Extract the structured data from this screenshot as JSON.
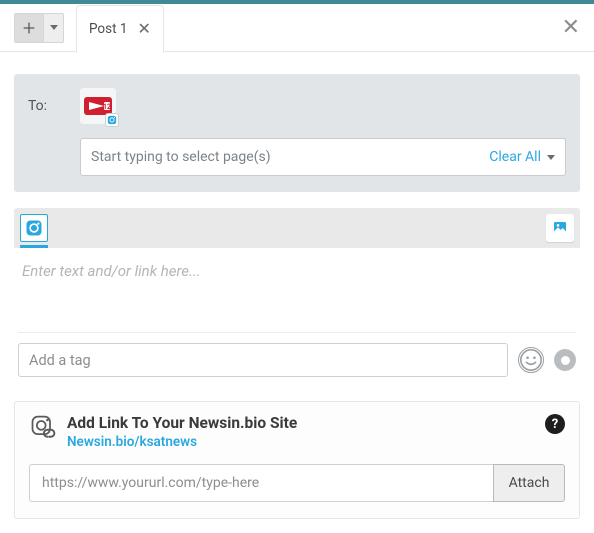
{
  "tab": {
    "label": "Post 1"
  },
  "to": {
    "label": "To:",
    "page_input_placeholder": "Start typing to select page(s)",
    "clear_all": "Clear All"
  },
  "editor": {
    "placeholder": "Enter text and/or link here...",
    "tag_placeholder": "Add a tag"
  },
  "linkpanel": {
    "title": "Add Link To Your Newsin.bio Site",
    "site": "Newsin.bio/ksatnews",
    "url_placeholder": "https://www.yoururl.com/type-here",
    "attach": "Attach",
    "help": "?"
  }
}
